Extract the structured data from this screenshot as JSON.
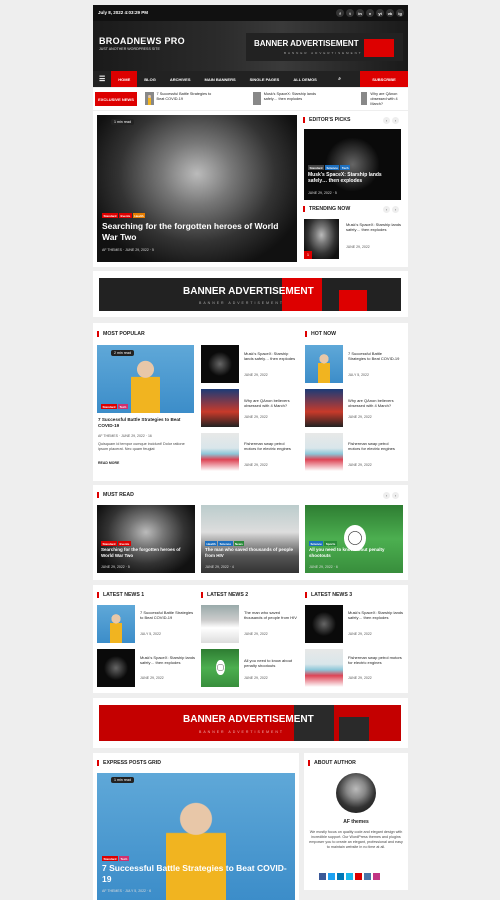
{
  "topbar": {
    "date": "July 8, 2022 4:03:29 PM",
    "social": [
      "f",
      "t",
      "in",
      "v",
      "yt",
      "vk",
      "ig"
    ]
  },
  "header": {
    "logo": "BROADNEWS PRO",
    "tagline": "JUST ANOTHER WORDPRESS SITE",
    "banner_title": "BANNER ADVERTISEMENT",
    "banner_sub": "BANNER ADVERTISEMENT"
  },
  "nav": {
    "items": [
      "HOME",
      "BLOG",
      "ARCHIVES",
      "MAIN BANNERS",
      "SINGLE PAGES",
      "ALL DEMOS"
    ],
    "subscribe": "SUBSCRIBE"
  },
  "exclusive": {
    "label": "EXCLUSIVE NEWS",
    "items": [
      "7 Successful Battle Strategies to Beat COVID-19",
      "Musk's SpaceX: Starship lands safely… then explodes",
      "Why are QAnon obsessed with 4 March?"
    ]
  },
  "hero": {
    "read_time": "1 min read",
    "tags": [
      "Standard",
      "Events",
      "Health"
    ],
    "title": "Searching for the forgotten heroes of World War Two",
    "author": "AF THEMES",
    "date": "JUNE 29, 2022",
    "comments": "5"
  },
  "editors": {
    "title": "EDITOR'S PICKS",
    "tags": [
      "Standard",
      "Science",
      "Tech"
    ],
    "post_title": "Musk's SpaceX: Starship lands safely… then explodes",
    "date": "JUNE 29, 2022",
    "comments": "5"
  },
  "trending": {
    "title": "TRENDING NOW",
    "number": "1",
    "post_title": "Musk's SpaceX: Starship lands safely… then explodes",
    "date": "JUNE 29, 2022"
  },
  "banner2": {
    "title": "BANNER ADVERTISEMENT",
    "sub": "BANNER ADVERTISEMENT"
  },
  "popular": {
    "title": "MOST POPULAR",
    "read_time": "2 min read",
    "tags": [
      "Standard",
      "Tech"
    ],
    "main_title": "7 Successful Battle Strategies to Beat COVID-19",
    "author": "AF THEMES",
    "date": "JUNE 29, 2022",
    "comments": "16",
    "excerpt": "Quisquam id tempor cumque incidunt! Dolor ratione ipsum placerat. Nec quam feugiat",
    "read_more": "READ MORE",
    "list": [
      {
        "title": "Musk's SpaceX: Starship lands safely… then explodes",
        "date": "JUNE 29, 2022"
      },
      {
        "title": "Why are QAnon believers obsessed with 4 March?",
        "date": "JUNE 29, 2022"
      },
      {
        "title": "Fisherman swap petrol motors for electric engines",
        "date": "JUNE 29, 2022"
      }
    ]
  },
  "hotnow": {
    "title": "HOT NOW",
    "list": [
      {
        "title": "7 Successful Battle Strategies to Beat COVID-19",
        "date": "JULY 5, 2022"
      },
      {
        "title": "Why are QAnon believers obsessed with 4 March?",
        "date": "JUNE 29, 2022"
      },
      {
        "title": "Fisherman swap petrol motors for electric engines",
        "date": "JUNE 29, 2022"
      }
    ]
  },
  "mustread": {
    "title": "MUST READ",
    "cards": [
      {
        "tags": [
          "Standard",
          "Events"
        ],
        "title": "Searching for the forgotten heroes of World War Two",
        "date": "JUNE 29, 2022",
        "comments": "5"
      },
      {
        "tags": [
          "Health",
          "Science",
          "News"
        ],
        "title": "The man who saved thousands of people from HIV",
        "date": "JUNE 29, 2022",
        "comments": "4"
      },
      {
        "tags": [
          "Science",
          "Sports"
        ],
        "title": "All you need to know about penalty shootouts",
        "date": "JUNE 29, 2022",
        "comments": "6"
      }
    ]
  },
  "latest": [
    {
      "title": "LATEST NEWS 1",
      "items": [
        {
          "title": "7 Successful Battle Strategies to Beat COVID-19",
          "date": "JULY 5, 2022"
        },
        {
          "title": "Musk's SpaceX: Starship lands safely… then explodes",
          "date": "JUNE 29, 2022"
        }
      ]
    },
    {
      "title": "LATEST NEWS 2",
      "items": [
        {
          "title": "The man who saved thousands of people from HIV",
          "date": "JUNE 29, 2022"
        },
        {
          "title": "All you need to know about penalty shootouts",
          "date": "JUNE 29, 2022"
        }
      ]
    },
    {
      "title": "LATEST NEWS 3",
      "items": [
        {
          "title": "Musk's SpaceX: Starship lands safely… then explodes",
          "date": "JUNE 29, 2022"
        },
        {
          "title": "Fisherman swap petrol motors for electric engines",
          "date": "JUNE 29, 2022"
        }
      ]
    }
  ],
  "banner3": {
    "title": "BANNER ADVERTISEMENT",
    "sub": "BANNER ADVERTISEMENT"
  },
  "express": {
    "title": "EXPRESS POSTS GRID",
    "read_time": "1 min read",
    "tags": [
      "Standard",
      "Tech"
    ],
    "post_title": "7 Successful Battle Strategies to Beat COVID-19",
    "author": "AF THEMES",
    "date": "JULY 5, 2022",
    "comments": "6"
  },
  "author": {
    "title": "ABOUT AUTHOR",
    "name": "AF themes",
    "bio": "We mostly focus on quality code and elegant design with incredible support. Our WordPress themes and plugins empower you to create an elegant, professional and easy to maintain website in no time at all."
  }
}
